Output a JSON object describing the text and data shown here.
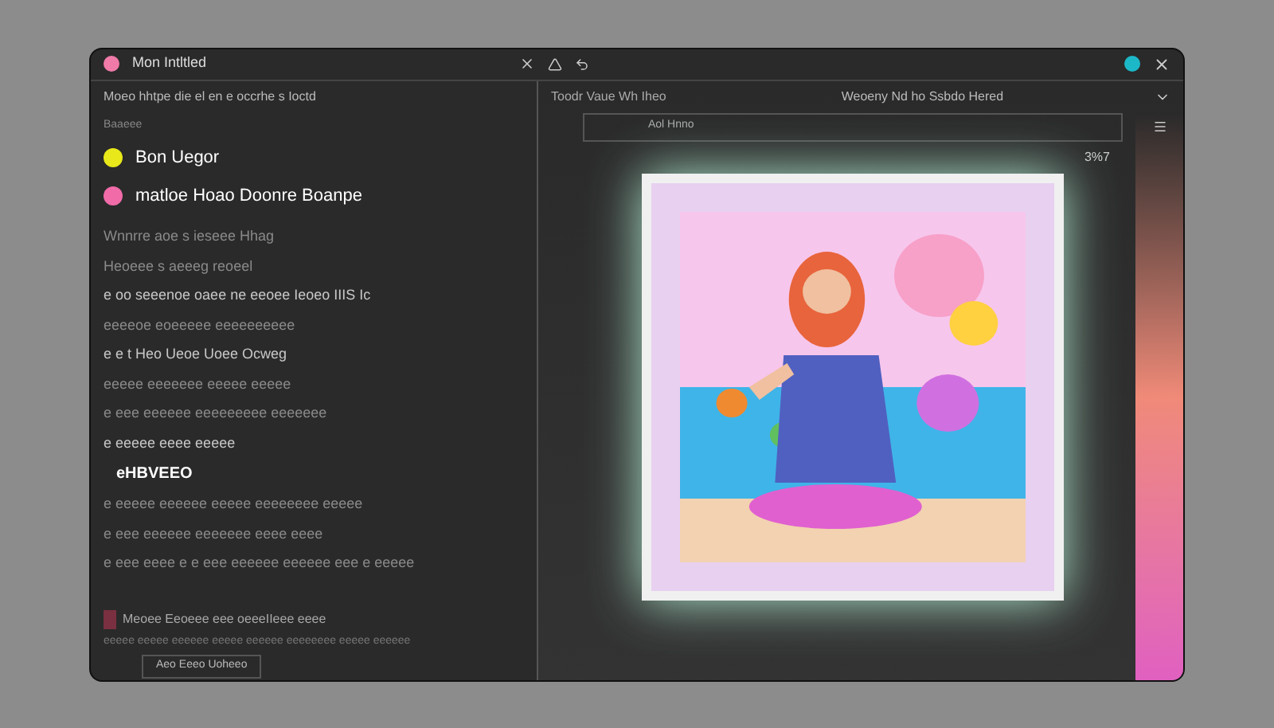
{
  "window": {
    "title": "Mon Intltled"
  },
  "left": {
    "subtitle": "Moeo hhtpe die el en e occrhe s Ioctd",
    "section_label": "Baaeee",
    "legend": [
      {
        "color": "#e8e81a",
        "text": "Bon Uegor"
      },
      {
        "color": "#f06ba8",
        "text": "matloe Hoao Doonre Boanpe"
      }
    ],
    "lines": [
      {
        "kind": "dim",
        "text": "Wnnrre aoe s ieseee Hhag"
      },
      {
        "kind": "dim",
        "text": "Heoeee s aeeeg reoeel"
      },
      {
        "kind": "bright",
        "text": "e oo seeenoe oaee ne eeoee Ieoeo IIIS Ic"
      },
      {
        "kind": "dim",
        "text": "eeeeoe eoeeeee eeeeeeeeee"
      },
      {
        "kind": "bright",
        "text": "e e t Heo Ueoe Uoee Ocweg"
      },
      {
        "kind": "dim",
        "text": "eeeee eeeeeee eeeee eeeee"
      },
      {
        "kind": "dim",
        "text": "e eee eeeeee eeeeeeeee eeeeeee"
      },
      {
        "kind": "bright",
        "text": "e eeeee eeee eeeee"
      },
      {
        "kind": "heading",
        "text": "eHBVEEO"
      },
      {
        "kind": "dim",
        "text": "e eeeee eeeeee eeeee eeeeeeee eeeee"
      },
      {
        "kind": "dim",
        "text": "e eee eeeeee eeeeeee eeee eeee"
      },
      {
        "kind": "dim",
        "text": "e eee eeee e e eee eeeeee eeeeee eee e eeeee"
      }
    ],
    "footer_line": "Meoee Eeoeee eee oeeeIIeee eeee",
    "footer_text": "eeeee eeeee eeeeee eeeee eeeeee eeeeeeee eeeee eeeeee",
    "footer_button": "Aeo Eeeo Uoheeo"
  },
  "right": {
    "header": "Toodr Vaue Wh Iheo",
    "center_title": "Weoeny Nd ho Ssbdo Hered",
    "pane_label": "Aol Hnno",
    "value": "3%7"
  }
}
